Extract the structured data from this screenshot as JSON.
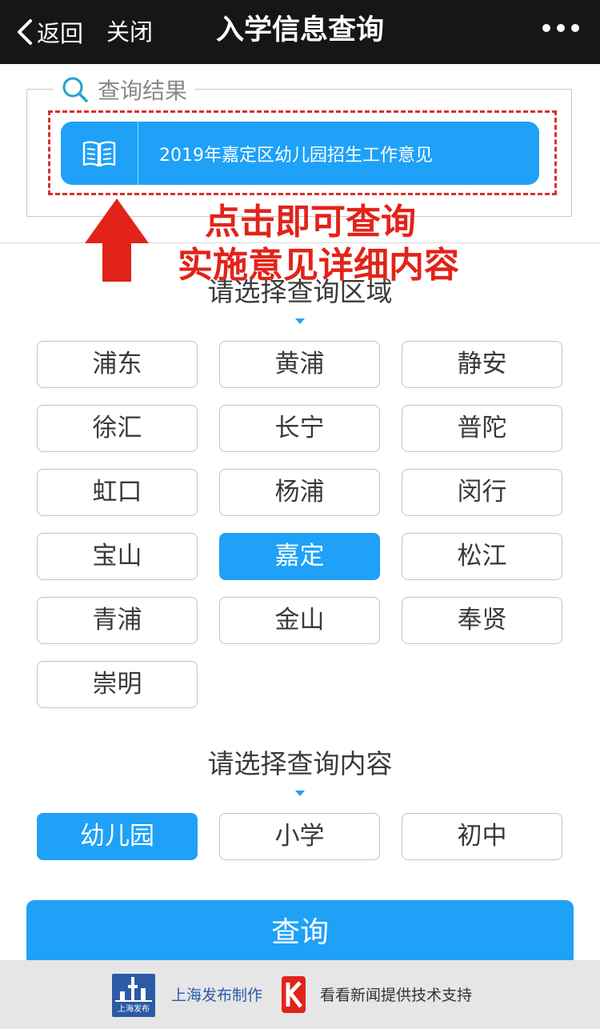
{
  "nav": {
    "back_label": "返回",
    "close_label": "关闭",
    "title": "入学信息查询"
  },
  "result": {
    "legend": "查询结果",
    "item_label": "2019年嘉定区幼儿园招生工作意见"
  },
  "annotation": {
    "line1": "点击即可查询",
    "line2": "实施意见详细内容"
  },
  "region": {
    "title": "请选择查询区域",
    "options": [
      "浦东",
      "黄浦",
      "静安",
      "徐汇",
      "长宁",
      "普陀",
      "虹口",
      "杨浦",
      "闵行",
      "宝山",
      "嘉定",
      "松江",
      "青浦",
      "金山",
      "奉贤",
      "崇明"
    ],
    "selected": "嘉定"
  },
  "content": {
    "title": "请选择查询内容",
    "options": [
      "幼儿园",
      "小学",
      "初中"
    ],
    "selected": "幼儿园"
  },
  "query_button": "查询",
  "footer": {
    "logo_text": "上海发布",
    "made_by": "上海发布制作",
    "support": "看看新闻提供技术支持"
  },
  "colors": {
    "accent": "#1ea1f7",
    "annotation": "#e2231a",
    "nav_bg": "#161616"
  }
}
